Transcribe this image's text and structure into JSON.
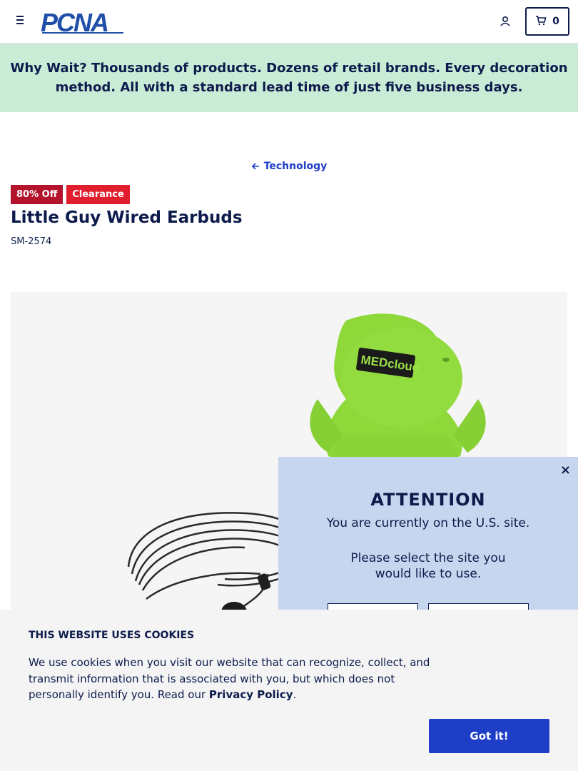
{
  "header": {
    "logo_text": "PCNA",
    "menu_icon": "hamburger-icon",
    "account_icon": "user-icon",
    "cart_icon": "cart-icon",
    "cart_count": "0"
  },
  "promo": {
    "lead": "Why Wait?",
    "text": " Thousands of products. Dozens of retail brands. Every decoration method. All with a standard lead time of just five business days."
  },
  "breadcrumb": {
    "icon": "arrow-left-icon",
    "label": "Technology"
  },
  "product": {
    "badges": [
      "80% Off",
      "Clearance"
    ],
    "title": "Little Guy Wired Earbuds",
    "sku": "SM-2574",
    "image_logo_text": "MEDcloud"
  },
  "site_modal": {
    "close_label": "×",
    "title": "ATTENTION",
    "line1": "You are currently on the U.S. site.",
    "line2": "Please select the site you",
    "line3": "would like to use."
  },
  "cookie": {
    "title": "THIS WEBSITE USES COOKIES",
    "text": "We use cookies when you visit our website that can recognize, collect, and transmit information that is associated with you, but which does not personally identify you. Read our ",
    "link": "Privacy Policy",
    "after": ".",
    "button": "Got it!"
  },
  "colors": {
    "navy": "#0d1b4c",
    "brand_blue": "#1e3ec8",
    "promo_bg": "#c9ecd6",
    "modal_bg": "#c6d6ee",
    "sale_red": "#b3142c",
    "clearance_red": "#e01e2e",
    "product_green": "#8ed83a"
  }
}
